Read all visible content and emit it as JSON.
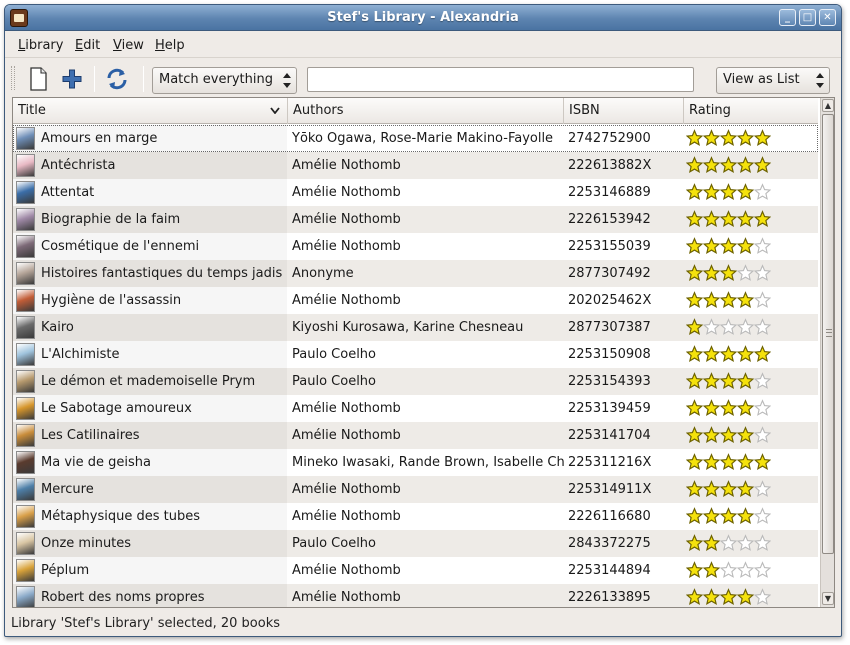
{
  "window": {
    "title": "Stef's Library - Alexandria",
    "icon": "book-icon"
  },
  "menubar": [
    {
      "label": "Library",
      "mnemonic": "L",
      "rest": "ibrary"
    },
    {
      "label": "Edit",
      "mnemonic": "E",
      "rest": "dit"
    },
    {
      "label": "View",
      "mnemonic": "V",
      "rest": "iew"
    },
    {
      "label": "Help",
      "mnemonic": "H",
      "rest": "elp"
    }
  ],
  "toolbar": {
    "new_icon": "new-document-icon",
    "add_icon": "add-icon",
    "refresh_icon": "refresh-icon",
    "filter_selected": "Match everything",
    "search_value": "",
    "view_selected": "View as List"
  },
  "columns": {
    "title": "Title",
    "authors": "Authors",
    "isbn": "ISBN",
    "rating": "Rating"
  },
  "rows": [
    {
      "title": "Amours en marge",
      "authors": "Yōko Ogawa, Rose-Marie Makino-Fayolle",
      "isbn": "2742752900",
      "rating": 5,
      "cover": "#6f8fb8"
    },
    {
      "title": "Antéchrista",
      "authors": "Amélie Nothomb",
      "isbn": "222613882X",
      "rating": 5,
      "cover": "#e8b9c4"
    },
    {
      "title": "Attentat",
      "authors": "Amélie Nothomb",
      "isbn": "2253146889",
      "rating": 4,
      "cover": "#3b6ea8"
    },
    {
      "title": "Biographie de la faim",
      "authors": "Amélie Nothomb",
      "isbn": "2226153942",
      "rating": 5,
      "cover": "#9f89a6"
    },
    {
      "title": "Cosmétique de l'ennemi",
      "authors": "Amélie Nothomb",
      "isbn": "2253155039",
      "rating": 4,
      "cover": "#7d6a78"
    },
    {
      "title": "Histoires fantastiques du temps jadis",
      "authors": "Anonyme",
      "isbn": "2877307492",
      "rating": 3,
      "cover": "#b6a69a"
    },
    {
      "title": "Hygiène de l'assassin",
      "authors": "Amélie Nothomb",
      "isbn": "202025462X",
      "rating": 4,
      "cover": "#c25d37"
    },
    {
      "title": "Kairo",
      "authors": "Kiyoshi Kurosawa, Karine Chesneau",
      "isbn": "2877307387",
      "rating": 1,
      "cover": "#6b6b6b"
    },
    {
      "title": "L'Alchimiste",
      "authors": "Paulo Coelho",
      "isbn": "2253150908",
      "rating": 5,
      "cover": "#9fc3dd"
    },
    {
      "title": "Le démon et mademoiselle Prym",
      "authors": "Paulo Coelho",
      "isbn": "2253154393",
      "rating": 4,
      "cover": "#b79a6e"
    },
    {
      "title": "Le Sabotage amoureux",
      "authors": "Amélie Nothomb",
      "isbn": "2253139459",
      "rating": 4,
      "cover": "#d6962c"
    },
    {
      "title": "Les Catilinaires",
      "authors": "Amélie Nothomb",
      "isbn": "2253141704",
      "rating": 4,
      "cover": "#c98d3b"
    },
    {
      "title": "Ma vie de geisha",
      "authors": "Mineko Iwasaki, Rande Brown, Isabelle Cha",
      "isbn": "225311216X",
      "rating": 5,
      "cover": "#5a3b2e"
    },
    {
      "title": "Mercure",
      "authors": "Amélie Nothomb",
      "isbn": "225314911X",
      "rating": 4,
      "cover": "#4e7fa8"
    },
    {
      "title": "Métaphysique des tubes",
      "authors": "Amélie Nothomb",
      "isbn": "2226116680",
      "rating": 4,
      "cover": "#d9a04a"
    },
    {
      "title": "Onze minutes",
      "authors": "Paulo Coelho",
      "isbn": "2843372275",
      "rating": 2,
      "cover": "#d9c6a4"
    },
    {
      "title": "Péplum",
      "authors": "Amélie Nothomb",
      "isbn": "2253144894",
      "rating": 2,
      "cover": "#d8a23a"
    },
    {
      "title": "Robert des noms propres",
      "authors": "Amélie Nothomb",
      "isbn": "2226133895",
      "rating": 4,
      "cover": "#8aa9c8"
    }
  ],
  "status": "Library 'Stef's Library' selected, 20 books",
  "colors": {
    "titlebar": "#5d84b0",
    "star": "#f5e20c",
    "zebra": "#eeebe7"
  }
}
